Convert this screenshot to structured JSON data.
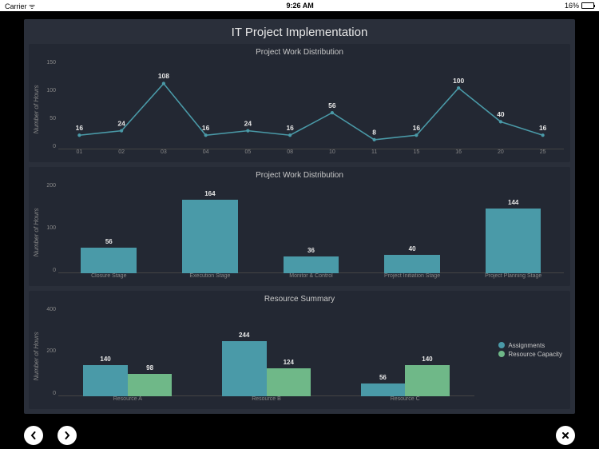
{
  "status": {
    "carrier": "Carrier",
    "wifi": "●",
    "time": "9:26 AM",
    "battery_pct": "16%"
  },
  "dashboard_title": "IT Project Implementation",
  "chart1": {
    "title": "Project Work Distribution",
    "ylabel": "Number of Hours",
    "yticks": [
      "150",
      "100",
      "50",
      "0"
    ],
    "categories": [
      "01",
      "02",
      "03",
      "04",
      "05",
      "08",
      "10",
      "11",
      "15",
      "16",
      "20",
      "25"
    ],
    "values": [
      16,
      24,
      108,
      16,
      24,
      16,
      56,
      8,
      16,
      100,
      40,
      16
    ],
    "ymax": 150
  },
  "chart2": {
    "title": "Project Work Distribution",
    "ylabel": "Number of Hours",
    "yticks": [
      "200",
      "100",
      "0"
    ],
    "categories": [
      "Closure Stage",
      "Execution Stage",
      "Monitor & Control",
      "Project Initiation Stage",
      "Project Planning Stage"
    ],
    "values": [
      56,
      164,
      36,
      40,
      144
    ],
    "ymax": 200
  },
  "chart3": {
    "title": "Resource Summary",
    "ylabel": "Number of Hours",
    "yticks": [
      "400",
      "200",
      "0"
    ],
    "categories": [
      "Resource A",
      "Resource B",
      "Resource C"
    ],
    "series": [
      {
        "name": "Assignments",
        "values": [
          140,
          244,
          56
        ]
      },
      {
        "name": "Resource Capacity",
        "values": [
          98,
          124,
          140
        ]
      }
    ],
    "ymax": 400
  },
  "chart_data": [
    {
      "type": "line",
      "title": "Project Work Distribution",
      "xlabel": "",
      "ylabel": "Number of Hours",
      "ylim": [
        0,
        150
      ],
      "categories": [
        "01",
        "02",
        "03",
        "04",
        "05",
        "08",
        "10",
        "11",
        "15",
        "16",
        "20",
        "25"
      ],
      "values": [
        16,
        24,
        108,
        16,
        24,
        16,
        56,
        8,
        16,
        100,
        40,
        16
      ]
    },
    {
      "type": "bar",
      "title": "Project Work Distribution",
      "xlabel": "",
      "ylabel": "Number of Hours",
      "ylim": [
        0,
        200
      ],
      "categories": [
        "Closure Stage",
        "Execution Stage",
        "Monitor & Control",
        "Project Initiation Stage",
        "Project Planning Stage"
      ],
      "values": [
        56,
        164,
        36,
        40,
        144
      ]
    },
    {
      "type": "bar",
      "title": "Resource Summary",
      "xlabel": "",
      "ylabel": "Number of Hours",
      "ylim": [
        0,
        400
      ],
      "categories": [
        "Resource A",
        "Resource B",
        "Resource C"
      ],
      "series": [
        {
          "name": "Assignments",
          "values": [
            140,
            244,
            56
          ]
        },
        {
          "name": "Resource Capacity",
          "values": [
            98,
            124,
            140
          ]
        }
      ]
    }
  ]
}
